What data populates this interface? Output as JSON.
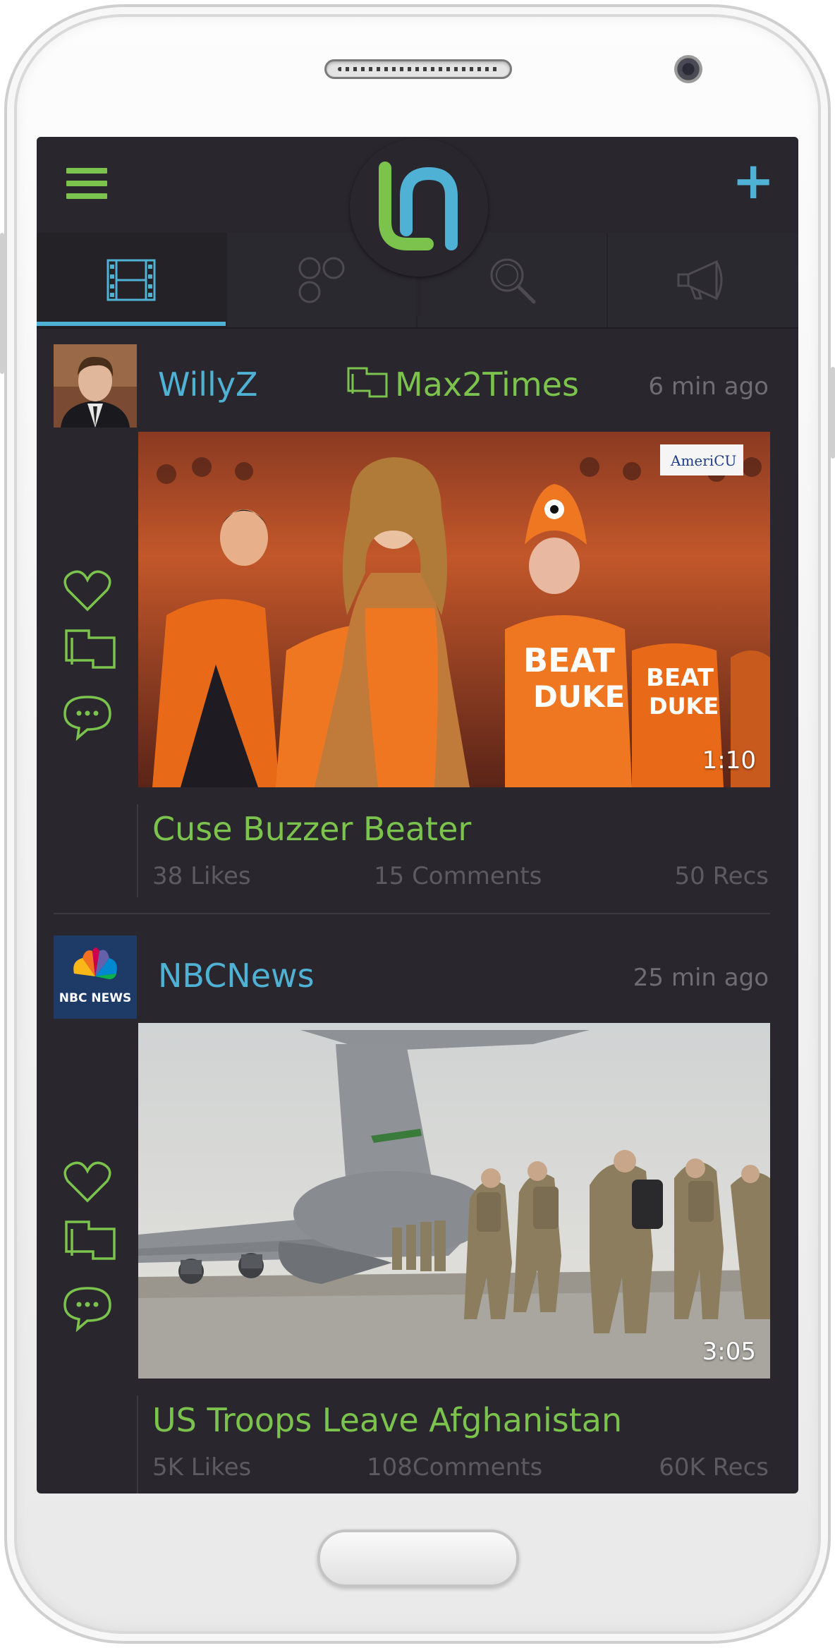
{
  "app": {
    "colors": {
      "accent_blue": "#4fb1d3",
      "accent_green": "#7bc34d",
      "background": "#29272d",
      "muted_text": "#6f6c74"
    },
    "header": {
      "menu_icon": "hamburger-menu-icon",
      "logo_icon": "app-logo-icon",
      "add_icon": "plus-icon"
    },
    "tabs": [
      {
        "icon": "film-strip-icon",
        "active": true
      },
      {
        "icon": "circles-icon",
        "active": false
      },
      {
        "icon": "search-icon",
        "active": false
      },
      {
        "icon": "megaphone-icon",
        "active": false
      }
    ]
  },
  "feed": [
    {
      "username": "WillyZ",
      "reshared_by": "Max2Times",
      "time": "6 min ago",
      "duration": "1:10",
      "title": "Cuse Buzzer Beater",
      "likes": "38 Likes",
      "comments": "15 Comments",
      "recs": "50 Recs"
    },
    {
      "username": "NBCNews",
      "avatar_text": "NBC NEWS",
      "time": "25 min ago",
      "duration": "3:05",
      "title": "US Troops Leave Afghanistan",
      "likes": "5K Likes",
      "comments": "108Comments",
      "recs": "60K Recs"
    }
  ]
}
